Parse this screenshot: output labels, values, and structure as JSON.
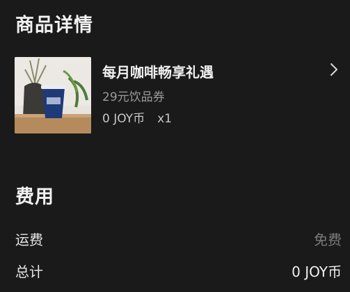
{
  "details": {
    "title": "商品详情"
  },
  "product": {
    "name": "每月咖啡畅享礼遇",
    "subtitle": "29元饮品券",
    "price": "0 JOY币",
    "quantity": "x1",
    "image_alt": "coffee-cup-photo",
    "chevron_icon": "chevron-right-icon"
  },
  "fees": {
    "title": "费用",
    "shipping_label": "运费",
    "shipping_value": "免费",
    "total_label": "总计",
    "total_value": "0 JOY币"
  },
  "colors": {
    "background": "#1a1a1a",
    "muted_text": "#7a7a7a"
  }
}
